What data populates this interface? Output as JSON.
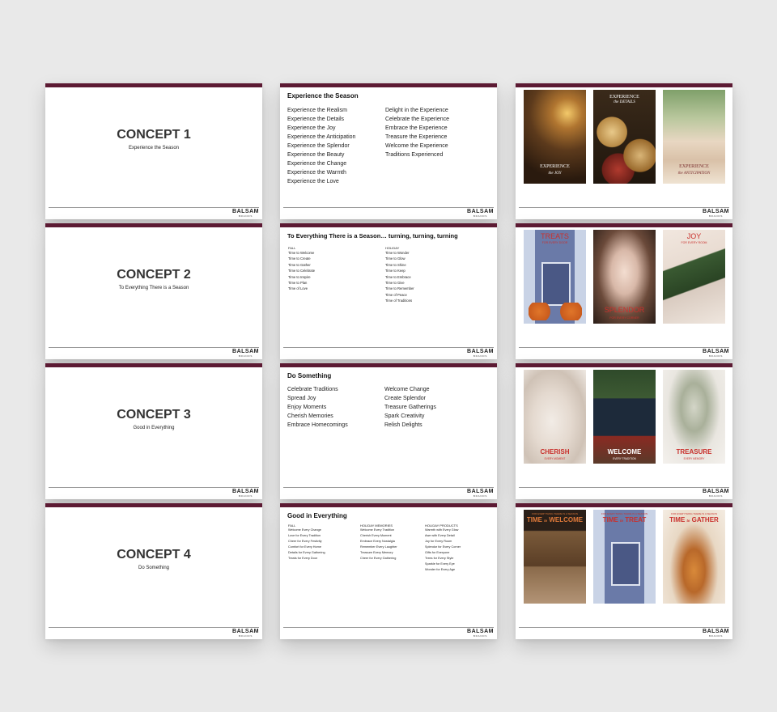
{
  "brand": {
    "name": "BALSAM",
    "sub": "BRANDS"
  },
  "concepts": [
    {
      "title": "CONCEPT 1",
      "subtitle": "Experience the Season"
    },
    {
      "title": "CONCEPT 2",
      "subtitle": "To Everything There is a Season"
    },
    {
      "title": "CONCEPT 3",
      "subtitle": "Good in Everything"
    },
    {
      "title": "CONCEPT 4",
      "subtitle": "Do Something"
    }
  ],
  "details": [
    {
      "title": "Experience the Season",
      "col1": [
        "Experience the Realism",
        "Experience the Details",
        "Experience the Joy",
        "Experience the Anticipation",
        "Experience the Splendor",
        "Experience the Beauty",
        "Experience the Change",
        "Experience the Warmth",
        "Experience the Love"
      ],
      "col2": [
        "Delight in the Experience",
        "Celebrate the Experience",
        "Embrace the Experience",
        "Treasure the Experience",
        "Welcome the Experience",
        "Traditions Experienced"
      ]
    },
    {
      "title": "To Everything There is a Season… turning,  turning, turning",
      "col1_header": "FALL",
      "col1": [
        "Time to Welcome",
        "Time to Create",
        "Time to Gather",
        "Time to Celebrate",
        "Time to Inspire",
        "Time to Plan",
        "Time of Love"
      ],
      "col2_header": "HOLIDAY",
      "col2": [
        "Time to Wonder",
        "Time to Glow",
        "Time to Shine",
        "Time to Keep",
        "Time to Embrace",
        "Time to Give",
        "Time to Remember",
        "Time of Peace",
        "Time of Traditions"
      ]
    },
    {
      "title": "Do Something",
      "col1": [
        "Celebrate Traditions",
        "Spread Joy",
        "Enjoy Moments",
        "Cherish Memories",
        "Embrace Homecomings"
      ],
      "col2": [
        "Welcome Change",
        "Create Splendor",
        "Treasure Gatherings",
        "Spark Creativity",
        "Relish Delights"
      ]
    },
    {
      "title": "Good in Everything",
      "col1_header": "FALL",
      "col1": [
        "Welcome Every Change",
        "Love for Every Tradition",
        "Cheer for Every Festivity",
        "Comfort for Every Home",
        "Details for Every Gathering",
        "Treats for Every Door"
      ],
      "col2_header": "HOLIDAY MEMORIES",
      "col2": [
        "Welcome Every Tradition",
        "Cherish Every Moment",
        "Embrace Every Nostalgia",
        "Remember Every Laughter",
        "Treasure Every Memory",
        "Cheer for Every Gathering"
      ],
      "col3_header": "HOLIDAY PRODUCTS",
      "col3": [
        "Warmth with Every Glow",
        "Awe with Every Detail",
        "Joy for Every Room",
        "Splendor for Every Corner",
        "Gifts for Everyone",
        "Trees for Every Style",
        "Sparkle for Every Eye",
        "Wonder for Every Age"
      ]
    }
  ],
  "photos": {
    "row1": [
      {
        "big": "EXPERIENCE",
        "small": "the JOY"
      },
      {
        "big": "EXPERIENCE",
        "small": "the DETAILS"
      },
      {
        "big": "EXPERIENCE",
        "small": "the ANTICIPATION"
      }
    ],
    "row2": [
      {
        "big": "TREATS",
        "small": "FOR EVERY DOOR"
      },
      {
        "big": "SPLENDOR",
        "small": "FOR EVERY CORNER"
      },
      {
        "big": "JOY",
        "small": "FOR EVERY ROOM"
      }
    ],
    "row3": [
      {
        "big": "CHERISH",
        "small": "EVERY MOMENT"
      },
      {
        "big": "WELCOME",
        "small": "EVERY TRADITION"
      },
      {
        "big": "TREASURE",
        "small": "EVERY MEMORY"
      }
    ],
    "row4": [
      {
        "small": "FOR EVERYTHING THERE IS A SEASON",
        "big1": "TIME",
        "to": "to",
        "big2": "WELCOME"
      },
      {
        "small": "FOR EVERYTHING THERE IS A SEASON",
        "big1": "TIME",
        "to": "to",
        "big2": "TREAT"
      },
      {
        "small": "FOR EVERYTHING THERE IS A SEASON",
        "big1": "TIME",
        "to": "to",
        "big2": "GATHER"
      }
    ]
  }
}
